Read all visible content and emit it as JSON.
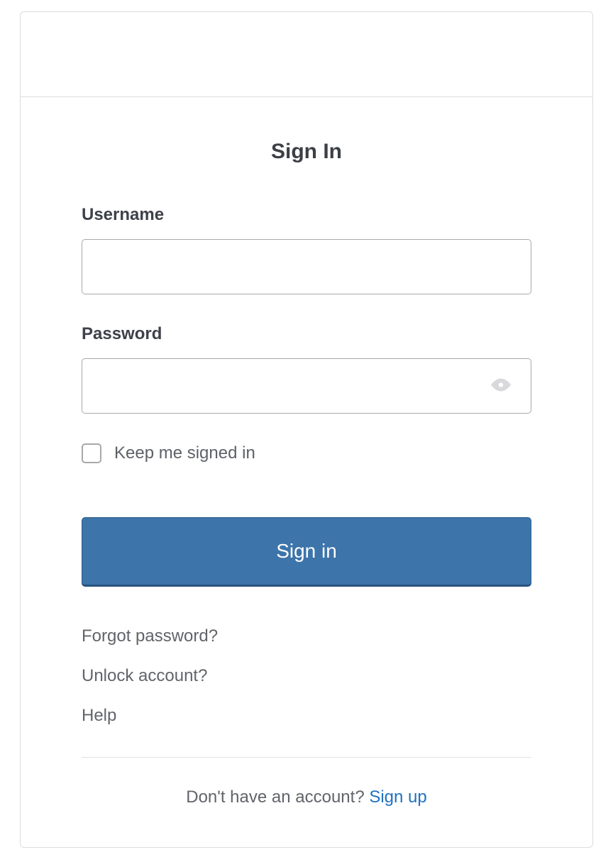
{
  "title": "Sign In",
  "form": {
    "username_label": "Username",
    "username_value": "",
    "password_label": "Password",
    "password_value": "",
    "keep_signed_in_label": "Keep me signed in",
    "submit_label": "Sign in"
  },
  "links": {
    "forgot_password": "Forgot password?",
    "unlock_account": "Unlock account?",
    "help": "Help"
  },
  "signup": {
    "prompt": "Don't have an account?",
    "link_label": "Sign up"
  }
}
